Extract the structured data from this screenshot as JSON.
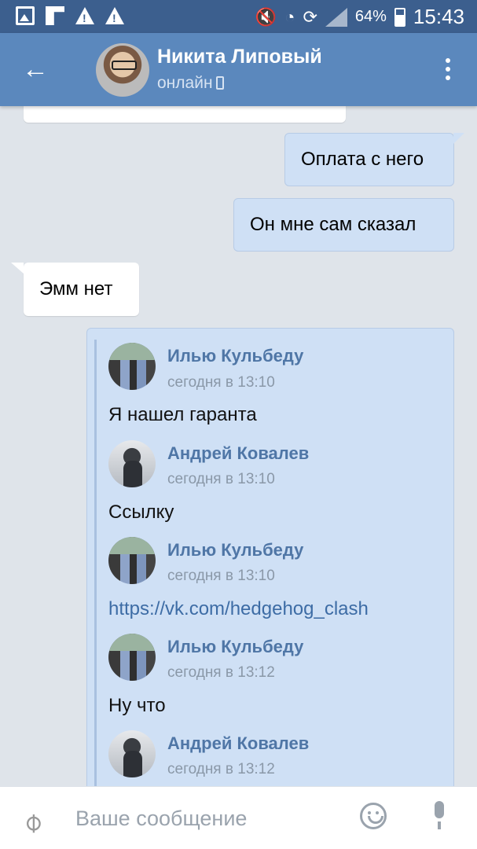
{
  "status_bar": {
    "battery": "64%",
    "time": "15:43"
  },
  "header": {
    "back_icon": "arrow-left-icon",
    "name": "Никита Липовый",
    "status": "онлайн",
    "menu_icon": "more-vertical-icon"
  },
  "messages": [
    {
      "direction": "out",
      "text": "Оплата с него"
    },
    {
      "direction": "out",
      "text": "Он мне сам сказал"
    },
    {
      "direction": "in",
      "text": "Эмм нет"
    }
  ],
  "forwarded": [
    {
      "author": "Илью Кульбеду",
      "time": "сегодня в 13:10",
      "text": "Я нашел гаранта"
    },
    {
      "author": "Андрей Ковалев",
      "time": "сегодня в 13:10",
      "text": "Ссылку"
    },
    {
      "author": "Илью Кульбеду",
      "time": "сегодня в 13:10",
      "text": "https://vk.com/hedgehog_clash"
    },
    {
      "author": "Илью Кульбеду",
      "time": "сегодня в 13:12",
      "text": "Ну что"
    },
    {
      "author": "Андрей Ковалев",
      "time": "сегодня в 13:12",
      "text": ""
    }
  ],
  "composer": {
    "placeholder": "Ваше сообщение"
  },
  "colors": {
    "status_bar": "#3c5f8e",
    "header": "#5b88bd",
    "outgoing": "#cfe0f5",
    "incoming": "#ffffff",
    "background": "#dfe4ea",
    "link": "#3d6ca5"
  }
}
